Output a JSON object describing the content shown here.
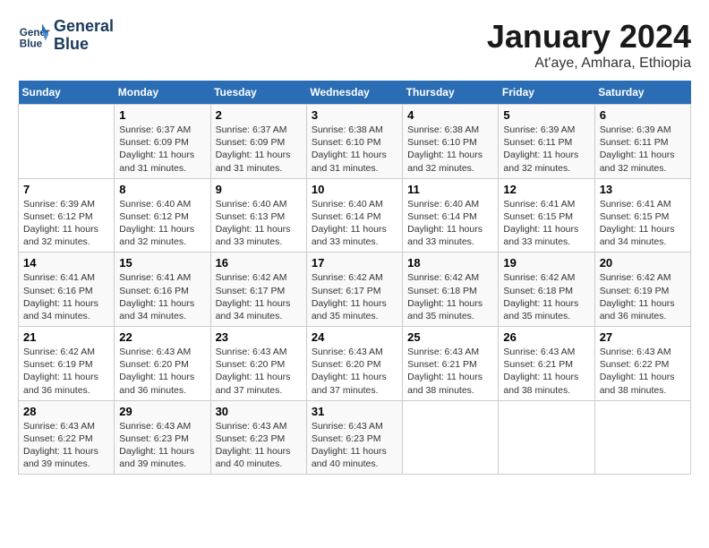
{
  "header": {
    "logo_line1": "General",
    "logo_line2": "Blue",
    "month_title": "January 2024",
    "subtitle": "At'aye, Amhara, Ethiopia"
  },
  "weekdays": [
    "Sunday",
    "Monday",
    "Tuesday",
    "Wednesday",
    "Thursday",
    "Friday",
    "Saturday"
  ],
  "weeks": [
    [
      {
        "day": "",
        "info": ""
      },
      {
        "day": "1",
        "info": "Sunrise: 6:37 AM\nSunset: 6:09 PM\nDaylight: 11 hours\nand 31 minutes."
      },
      {
        "day": "2",
        "info": "Sunrise: 6:37 AM\nSunset: 6:09 PM\nDaylight: 11 hours\nand 31 minutes."
      },
      {
        "day": "3",
        "info": "Sunrise: 6:38 AM\nSunset: 6:10 PM\nDaylight: 11 hours\nand 31 minutes."
      },
      {
        "day": "4",
        "info": "Sunrise: 6:38 AM\nSunset: 6:10 PM\nDaylight: 11 hours\nand 32 minutes."
      },
      {
        "day": "5",
        "info": "Sunrise: 6:39 AM\nSunset: 6:11 PM\nDaylight: 11 hours\nand 32 minutes."
      },
      {
        "day": "6",
        "info": "Sunrise: 6:39 AM\nSunset: 6:11 PM\nDaylight: 11 hours\nand 32 minutes."
      }
    ],
    [
      {
        "day": "7",
        "info": "Sunrise: 6:39 AM\nSunset: 6:12 PM\nDaylight: 11 hours\nand 32 minutes."
      },
      {
        "day": "8",
        "info": "Sunrise: 6:40 AM\nSunset: 6:12 PM\nDaylight: 11 hours\nand 32 minutes."
      },
      {
        "day": "9",
        "info": "Sunrise: 6:40 AM\nSunset: 6:13 PM\nDaylight: 11 hours\nand 33 minutes."
      },
      {
        "day": "10",
        "info": "Sunrise: 6:40 AM\nSunset: 6:14 PM\nDaylight: 11 hours\nand 33 minutes."
      },
      {
        "day": "11",
        "info": "Sunrise: 6:40 AM\nSunset: 6:14 PM\nDaylight: 11 hours\nand 33 minutes."
      },
      {
        "day": "12",
        "info": "Sunrise: 6:41 AM\nSunset: 6:15 PM\nDaylight: 11 hours\nand 33 minutes."
      },
      {
        "day": "13",
        "info": "Sunrise: 6:41 AM\nSunset: 6:15 PM\nDaylight: 11 hours\nand 34 minutes."
      }
    ],
    [
      {
        "day": "14",
        "info": "Sunrise: 6:41 AM\nSunset: 6:16 PM\nDaylight: 11 hours\nand 34 minutes."
      },
      {
        "day": "15",
        "info": "Sunrise: 6:41 AM\nSunset: 6:16 PM\nDaylight: 11 hours\nand 34 minutes."
      },
      {
        "day": "16",
        "info": "Sunrise: 6:42 AM\nSunset: 6:17 PM\nDaylight: 11 hours\nand 34 minutes."
      },
      {
        "day": "17",
        "info": "Sunrise: 6:42 AM\nSunset: 6:17 PM\nDaylight: 11 hours\nand 35 minutes."
      },
      {
        "day": "18",
        "info": "Sunrise: 6:42 AM\nSunset: 6:18 PM\nDaylight: 11 hours\nand 35 minutes."
      },
      {
        "day": "19",
        "info": "Sunrise: 6:42 AM\nSunset: 6:18 PM\nDaylight: 11 hours\nand 35 minutes."
      },
      {
        "day": "20",
        "info": "Sunrise: 6:42 AM\nSunset: 6:19 PM\nDaylight: 11 hours\nand 36 minutes."
      }
    ],
    [
      {
        "day": "21",
        "info": "Sunrise: 6:42 AM\nSunset: 6:19 PM\nDaylight: 11 hours\nand 36 minutes."
      },
      {
        "day": "22",
        "info": "Sunrise: 6:43 AM\nSunset: 6:20 PM\nDaylight: 11 hours\nand 36 minutes."
      },
      {
        "day": "23",
        "info": "Sunrise: 6:43 AM\nSunset: 6:20 PM\nDaylight: 11 hours\nand 37 minutes."
      },
      {
        "day": "24",
        "info": "Sunrise: 6:43 AM\nSunset: 6:20 PM\nDaylight: 11 hours\nand 37 minutes."
      },
      {
        "day": "25",
        "info": "Sunrise: 6:43 AM\nSunset: 6:21 PM\nDaylight: 11 hours\nand 38 minutes."
      },
      {
        "day": "26",
        "info": "Sunrise: 6:43 AM\nSunset: 6:21 PM\nDaylight: 11 hours\nand 38 minutes."
      },
      {
        "day": "27",
        "info": "Sunrise: 6:43 AM\nSunset: 6:22 PM\nDaylight: 11 hours\nand 38 minutes."
      }
    ],
    [
      {
        "day": "28",
        "info": "Sunrise: 6:43 AM\nSunset: 6:22 PM\nDaylight: 11 hours\nand 39 minutes."
      },
      {
        "day": "29",
        "info": "Sunrise: 6:43 AM\nSunset: 6:23 PM\nDaylight: 11 hours\nand 39 minutes."
      },
      {
        "day": "30",
        "info": "Sunrise: 6:43 AM\nSunset: 6:23 PM\nDaylight: 11 hours\nand 40 minutes."
      },
      {
        "day": "31",
        "info": "Sunrise: 6:43 AM\nSunset: 6:23 PM\nDaylight: 11 hours\nand 40 minutes."
      },
      {
        "day": "",
        "info": ""
      },
      {
        "day": "",
        "info": ""
      },
      {
        "day": "",
        "info": ""
      }
    ]
  ]
}
